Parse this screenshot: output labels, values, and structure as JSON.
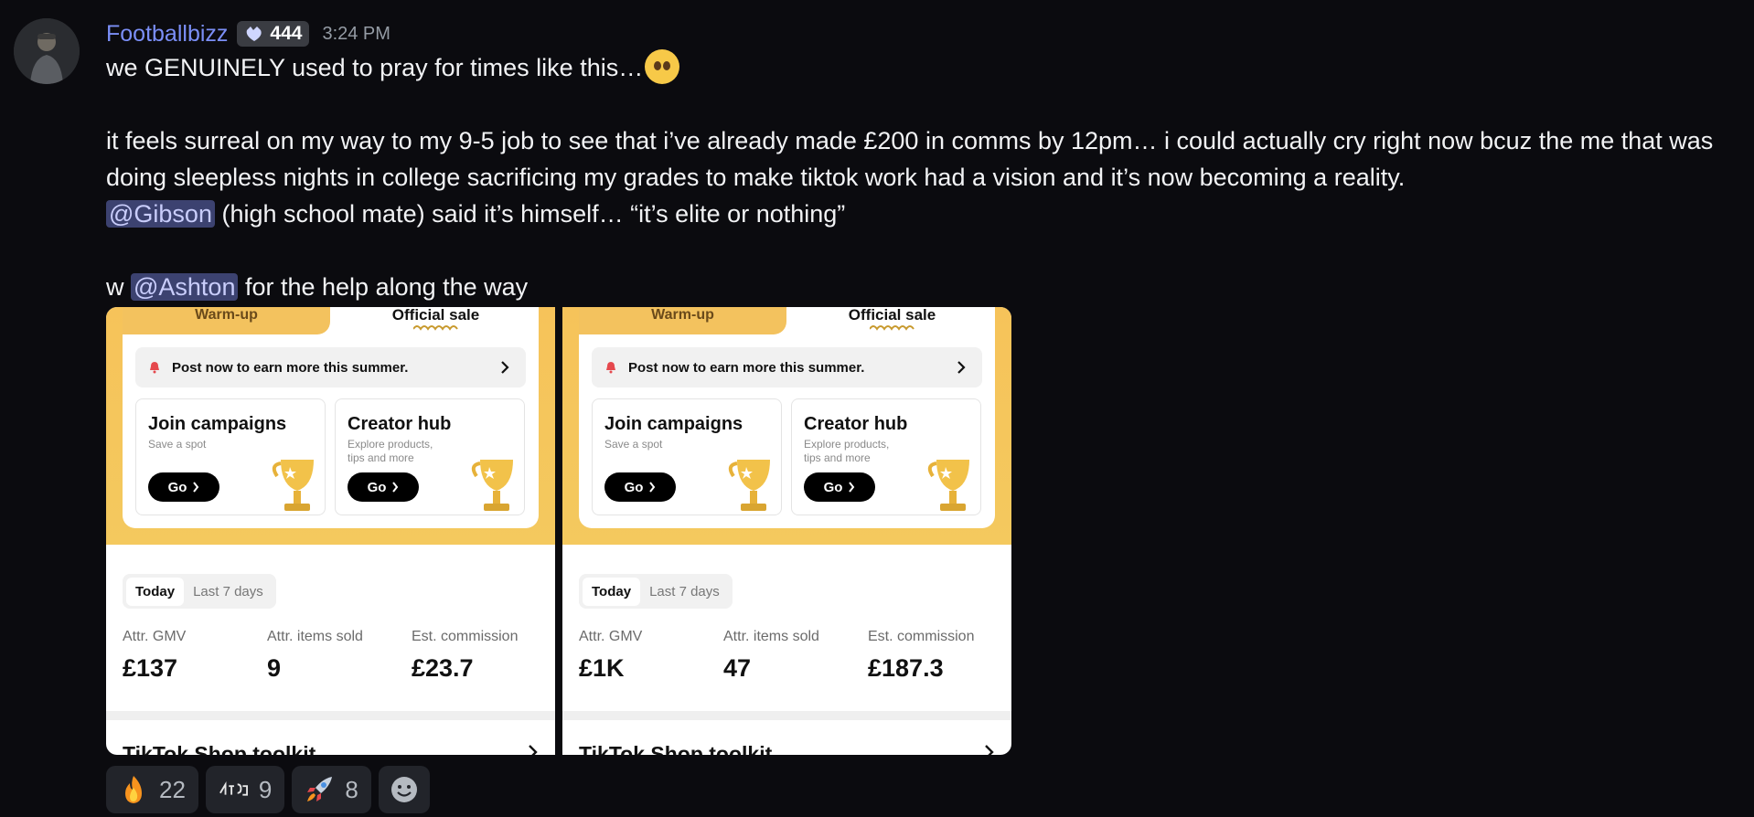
{
  "message": {
    "username": "Footballbizz",
    "badge_count": "444",
    "timestamp": "3:24 PM",
    "line1": "we GENUINELY used to pray for times like this…",
    "para2_line1": "it feels surreal on my way to my 9-5 job to see that i’ve already made £200 in comms by 12pm… i could actually cry right now bcuz the me that was",
    "para2_line2": "doing sleepless nights in college sacrificing my grades to make tiktok work had a vision and it’s now becoming a reality.",
    "mention1": "@Gibson",
    "para3_rest": " (high school mate) said it’s himself… “it’s elite or nothing”",
    "para4_prefix": "w ",
    "mention2": "@Ashton",
    "para4_suffix": " for the help along the way"
  },
  "screenshots": [
    {
      "tab_warmup": "Warm-up",
      "tab_official": "Official sale",
      "banner": "Post now to earn more this summer.",
      "tile1_title": "Join campaigns",
      "tile1_sub": "Save a spot",
      "tile2_title": "Creator hub",
      "tile2_sub": "Explore products, tips and more",
      "go_label": "Go",
      "period_today": "Today",
      "period_week": "Last 7 days",
      "stat1_label": "Attr. GMV",
      "stat1_value": "£137",
      "stat2_label": "Attr. items sold",
      "stat2_value": "9",
      "stat3_label": "Est. commission",
      "stat3_value": "£23.7",
      "toolkit": "TikTok Shop toolkit"
    },
    {
      "tab_warmup": "Warm-up",
      "tab_official": "Official sale",
      "banner": "Post now to earn more this summer.",
      "tile1_title": "Join campaigns",
      "tile1_sub": "Save a spot",
      "tile2_title": "Creator hub",
      "tile2_sub": "Explore products, tips and more",
      "go_label": "Go",
      "period_today": "Today",
      "period_week": "Last 7 days",
      "stat1_label": "Attr. GMV",
      "stat1_value": "£1K",
      "stat2_label": "Attr. items sold",
      "stat2_value": "47",
      "stat3_label": "Est. commission",
      "stat3_value": "£187.3",
      "toolkit": "TikTok Shop toolkit"
    }
  ],
  "reactions": [
    {
      "icon": "fire-icon",
      "count": "22"
    },
    {
      "icon": "custom-emoji-icon",
      "count": "9"
    },
    {
      "icon": "rocket-icon",
      "count": "8"
    }
  ],
  "colors": {
    "mention_bg": "#3c4270",
    "username": "#7b8ff7",
    "gold": "#f6c35a"
  }
}
